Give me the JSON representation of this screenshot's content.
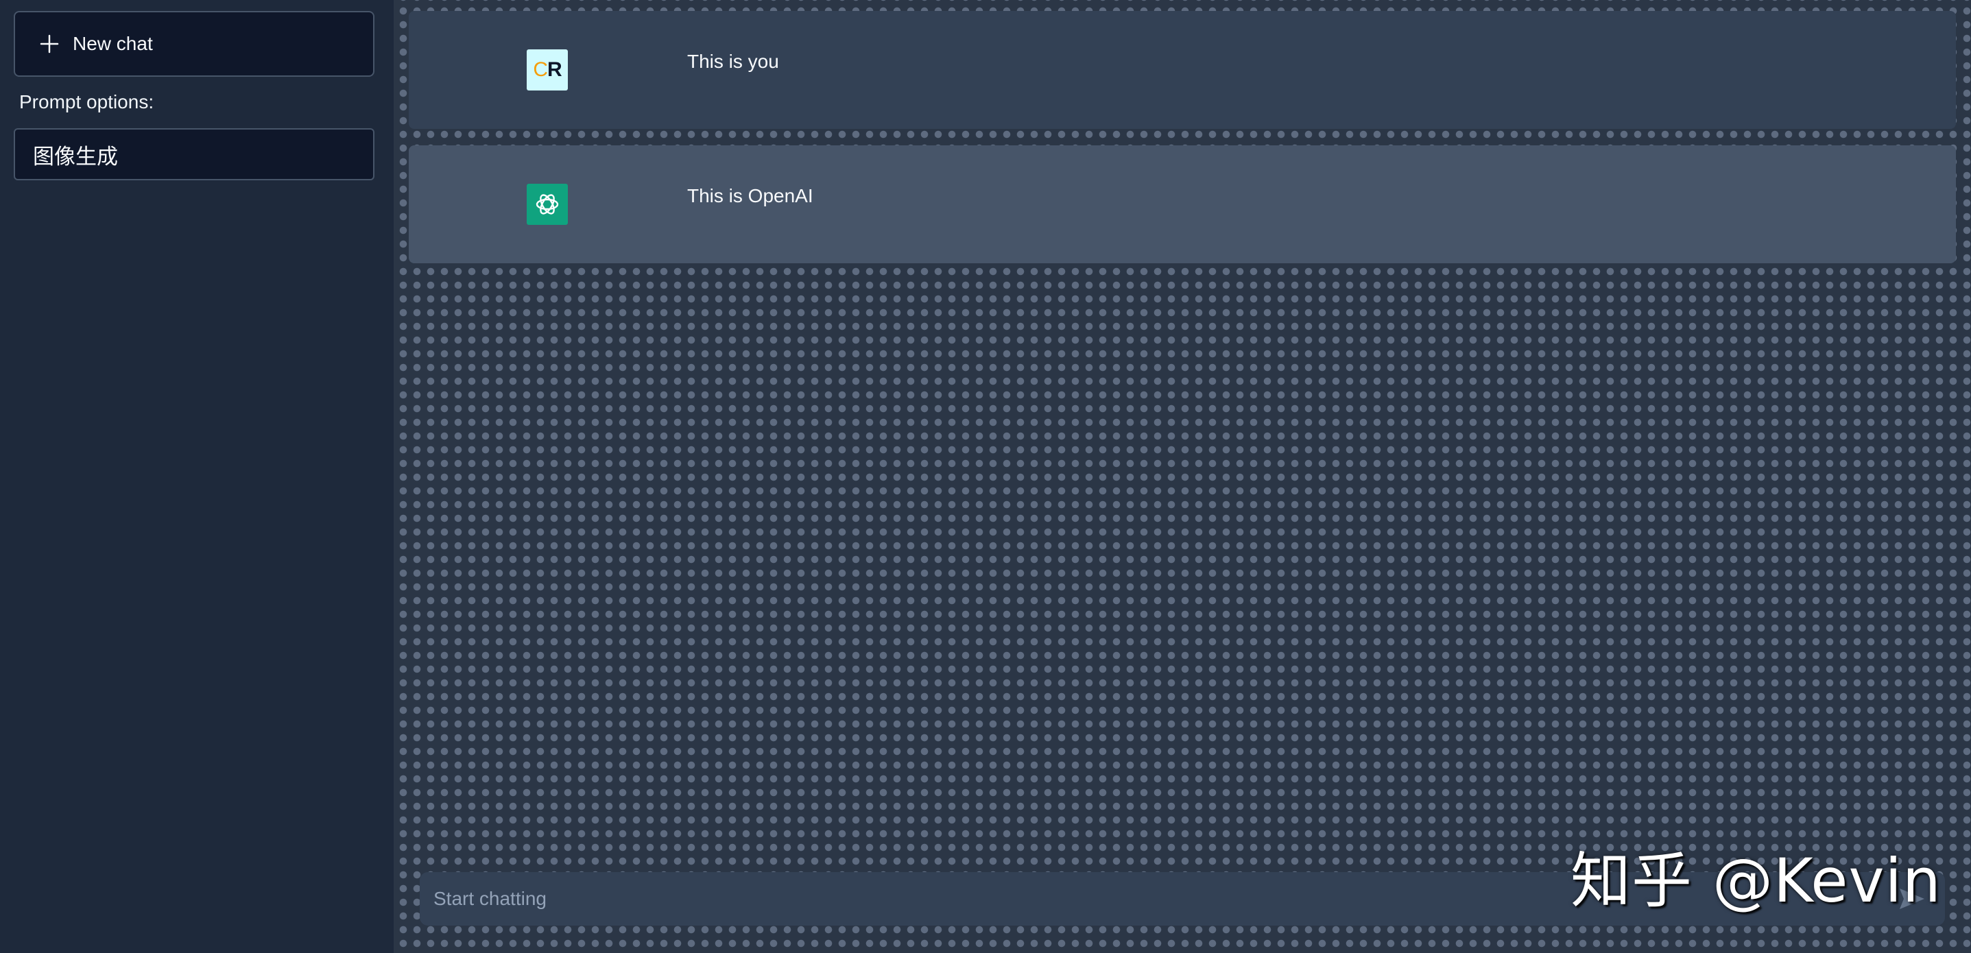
{
  "sidebar": {
    "new_chat_label": "New chat",
    "prompt_options_label": "Prompt options:",
    "prompt_selected": "图像生成"
  },
  "messages": [
    {
      "role": "user",
      "avatar_text_c": "C",
      "avatar_text_r": "R",
      "text": "This is you"
    },
    {
      "role": "assistant",
      "avatar_icon": "openai-logo-icon",
      "text": "This is OpenAI"
    }
  ],
  "input": {
    "placeholder": "Start chatting",
    "send_icon": "send-icon"
  },
  "watermark": "知乎 @Kevin",
  "colors": {
    "sidebar_bg": "#1e293b",
    "button_bg": "#0f172a",
    "user_msg_bg": "#334155",
    "bot_msg_bg": "#475569",
    "openai_green": "#10a37f",
    "user_avatar_bg": "#cffafe"
  }
}
